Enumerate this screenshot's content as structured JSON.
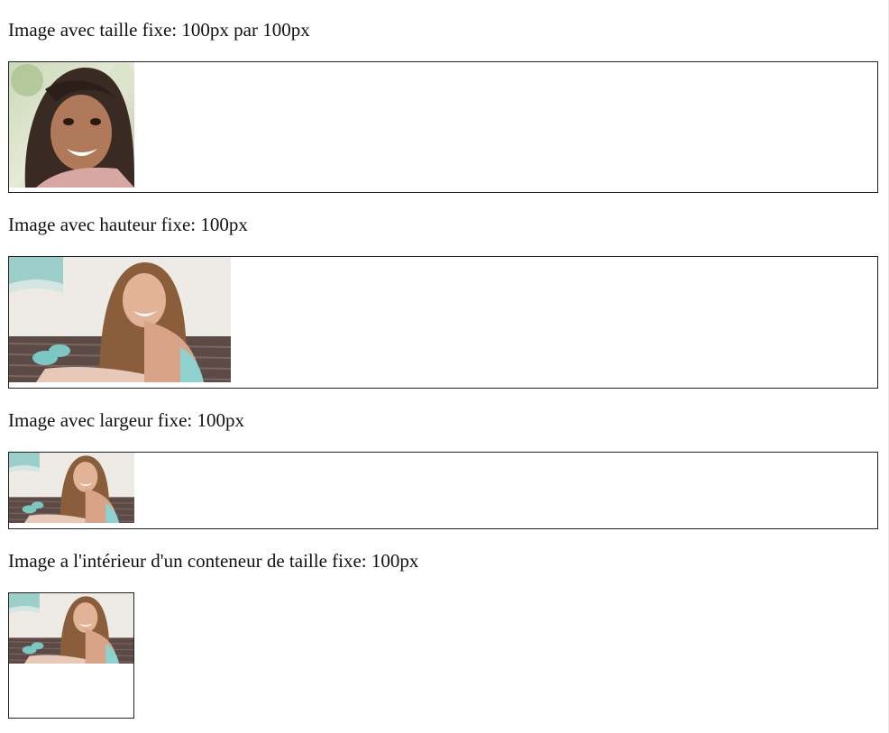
{
  "sections": [
    {
      "caption": "Image avec taille fixe: 100px par 100px"
    },
    {
      "caption": "Image avec hauteur fixe: 100px"
    },
    {
      "caption": "Image avec largeur fixe: 100px"
    },
    {
      "caption": "Image a l'intérieur d'un conteneur de taille fixe: 100px"
    }
  ]
}
